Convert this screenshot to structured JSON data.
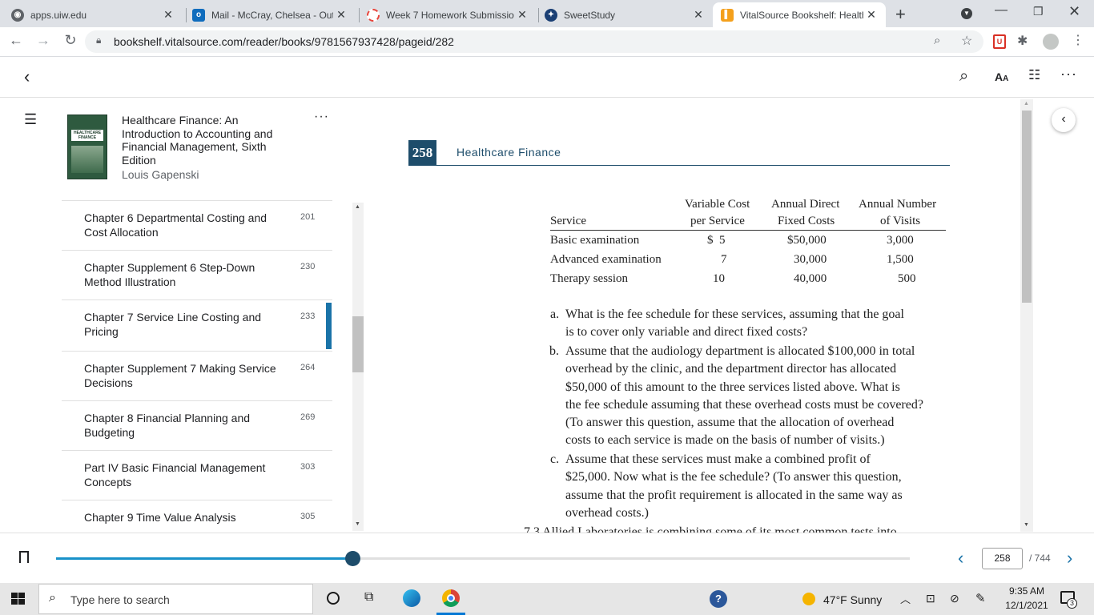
{
  "browser": {
    "tabs": [
      {
        "title": "apps.uiw.edu",
        "icon": "globe-icon"
      },
      {
        "title": "Mail - McCray, Chelsea - Outl",
        "icon": "outlook-icon"
      },
      {
        "title": "Week 7 Homework Submissio",
        "icon": "loading-icon"
      },
      {
        "title": "SweetStudy",
        "icon": "sweetstudy-icon"
      },
      {
        "title": "VitalSource Bookshelf: Health",
        "icon": "vitalsource-icon"
      }
    ],
    "url": "bookshelf.vitalsource.com/reader/books/9781567937428/pageid/282"
  },
  "book": {
    "title": "Healthcare Finance: An Introduction to Accounting and Financial Management, Sixth Edition",
    "author": "Louis Gapenski",
    "cover_text_1": "HEALTHCARE",
    "cover_text_2": "FINANCE"
  },
  "toc": [
    {
      "title": "Chapter 6 Departmental Costing and Cost Allocation",
      "page": "201"
    },
    {
      "title": "Chapter Supplement 6 Step-Down Method Illustration",
      "page": "230"
    },
    {
      "title": "Chapter 7 Service Line Costing and Pricing",
      "page": "233"
    },
    {
      "title": "Chapter Supplement 7 Making Service Decisions",
      "page": "264"
    },
    {
      "title": "Chapter 8 Financial Planning and Budgeting",
      "page": "269"
    },
    {
      "title": "Part IV Basic Financial Management Concepts",
      "page": "303"
    },
    {
      "title": "Chapter 9 Time Value Analysis",
      "page": "305"
    }
  ],
  "page": {
    "number": "258",
    "running_head": "Healthcare Finance",
    "table": {
      "headers": {
        "service": "Service",
        "vc_1": "Variable Cost",
        "vc_2": "per Service",
        "fc_1": "Annual Direct",
        "fc_2": "Fixed Costs",
        "vis_1": "Annual Number",
        "vis_2": "of Visits"
      },
      "rows": [
        {
          "service": "Basic examination",
          "vc": "$  5",
          "fc": "$50,000",
          "visits": "3,000"
        },
        {
          "service": "Advanced examination",
          "vc": "7",
          "fc": "30,000",
          "visits": "1,500"
        },
        {
          "service": "Therapy session",
          "vc": "10",
          "fc": "40,000",
          "visits": "500"
        }
      ]
    },
    "questions": [
      {
        "label": "a.",
        "lines": [
          "What is the fee schedule for these services, assuming that the goal",
          "is to cover only variable and direct fixed costs?"
        ]
      },
      {
        "label": "b.",
        "lines": [
          "Assume that the audiology department is allocated $100,000 in total",
          "overhead by the clinic, and the department director has allocated",
          "$50,000 of this amount to the three services listed above. What is",
          "the fee schedule assuming that these overhead costs must be covered?",
          "(To answer this question, assume that the allocation of overhead",
          "costs to each service is made on the basis of number of visits.)"
        ]
      },
      {
        "label": "c.",
        "lines": [
          "Assume that these services must make a combined profit of",
          "$25,000. Now what is the fee schedule? (To answer this question,",
          "assume that the profit requirement is allocated in the same way as",
          "overhead costs.)"
        ]
      }
    ],
    "next_partial": "7.3  Allied Laboratories is combining some of its most common tests into"
  },
  "pager": {
    "current": "258",
    "total": "/ 744",
    "progress": 0.347
  },
  "taskbar": {
    "search_placeholder": "Type here to search",
    "weather": "47°F  Sunny",
    "time": "9:35 AM",
    "date": "12/1/2021",
    "notif_count": "3"
  },
  "colors": {
    "accent": "#1a73a8",
    "progress": "#1891c9",
    "scrub": "#1e4d6b"
  }
}
